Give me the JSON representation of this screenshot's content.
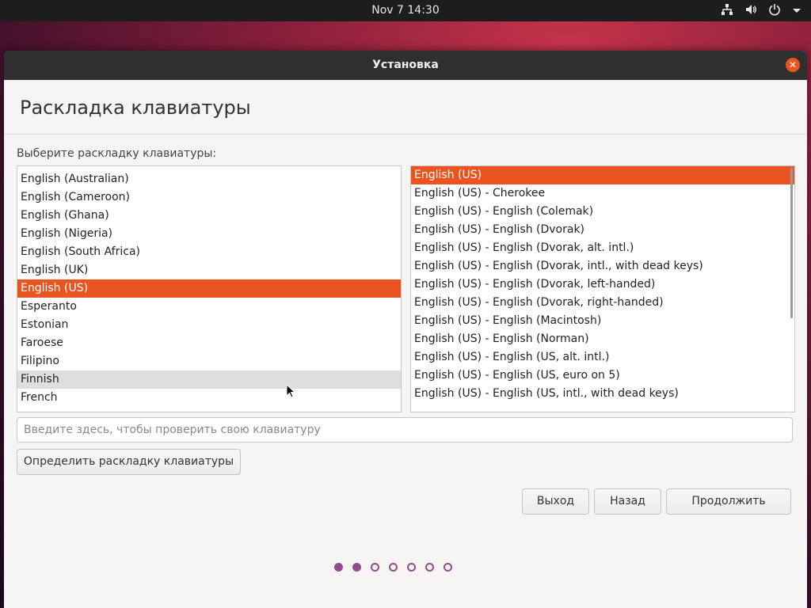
{
  "topbar": {
    "clock": "Nov 7  14:30",
    "icons": [
      "network-icon",
      "volume-icon",
      "power-icon",
      "menu-arrow-icon"
    ]
  },
  "window": {
    "title": "Установка",
    "page_title": "Раскладка клавиатуры",
    "prompt": "Выберите раскладку клавиатуры:"
  },
  "layouts": {
    "items": [
      "English (Australian)",
      "English (Cameroon)",
      "English (Ghana)",
      "English (Nigeria)",
      "English (South Africa)",
      "English (UK)",
      "English (US)",
      "Esperanto",
      "Estonian",
      "Faroese",
      "Filipino",
      "Finnish",
      "French"
    ],
    "selected": "English (US)",
    "hovered": "Finnish"
  },
  "variants": {
    "items": [
      "English (US)",
      "English (US) - Cherokee",
      "English (US) - English (Colemak)",
      "English (US) - English (Dvorak)",
      "English (US) - English (Dvorak, alt. intl.)",
      "English (US) - English (Dvorak, intl., with dead keys)",
      "English (US) - English (Dvorak, left-handed)",
      "English (US) - English (Dvorak, right-handed)",
      "English (US) - English (Macintosh)",
      "English (US) - English (Norman)",
      "English (US) - English (US, alt. intl.)",
      "English (US) - English (US, euro on 5)",
      "English (US) - English (US, intl., with dead keys)"
    ],
    "selected": "English (US)"
  },
  "test_input": {
    "placeholder": "Введите здесь, чтобы проверить свою клавиатуру",
    "value": ""
  },
  "buttons": {
    "detect": "Определить раскладку клавиатуры",
    "quit": "Выход",
    "back": "Назад",
    "continue": "Продолжить"
  },
  "progress": {
    "total_steps": 7,
    "completed_steps": 2
  },
  "colors": {
    "accent": "#e95420",
    "progress": "#924d8b"
  }
}
